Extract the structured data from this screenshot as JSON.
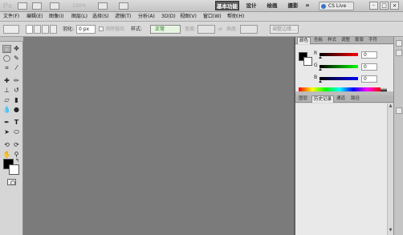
{
  "appbar": {
    "logo": "Ps",
    "zoom": "100%",
    "workspaces": [
      "基本功能",
      "设计",
      "绘画",
      "摄影"
    ],
    "more_label": "»",
    "cs_live_label": "CS Live",
    "window_controls": [
      "-",
      "□",
      "×"
    ]
  },
  "menu": {
    "items": [
      "文件(F)",
      "编辑(E)",
      "图像(I)",
      "图层(L)",
      "选择(S)",
      "滤镜(T)",
      "分析(A)",
      "3D(D)",
      "视图(V)",
      "窗口(W)",
      "帮助(H)"
    ]
  },
  "options": {
    "feather_label": "羽化:",
    "feather_value": "0 px",
    "antialias_label": "消除锯齿",
    "style_label": "样式:",
    "style_value": "正常",
    "width_label": "宽度:",
    "height_label": "高度:",
    "refine_edge_label": "调整边缘..."
  },
  "toolbox": {
    "tools": [
      "marquee-icon",
      "move-icon",
      "lasso-icon",
      "quick-select-icon",
      "crop-icon",
      "eyedropper-icon",
      "heal-icon",
      "brush-icon",
      "stamp-icon",
      "history-brush-icon",
      "eraser-icon",
      "gradient-icon",
      "blur-icon",
      "dodge-icon",
      "pen-icon",
      "type-icon",
      "path-select-icon",
      "shape-icon",
      "3d-rotate-icon",
      "3d-camera-icon",
      "hand-icon",
      "zoom-icon"
    ]
  },
  "color_panel": {
    "tabs": [
      "颜色",
      "色板",
      "样式",
      "调整",
      "蒙版",
      "字符"
    ],
    "channels": [
      {
        "label": "R",
        "value": "0",
        "gradient": "#ff0000"
      },
      {
        "label": "G",
        "value": "0",
        "gradient": "#00ff00"
      },
      {
        "label": "B",
        "value": "0",
        "gradient": "#0000ff"
      }
    ],
    "foreground": "#000000",
    "background": "#ffffff"
  },
  "history_panel": {
    "tabs": [
      "图层",
      "历史记录",
      "通道",
      "路径"
    ]
  },
  "colors": {
    "workspace": "#7b7b7b",
    "active_workspace": "#5a5a5a"
  }
}
